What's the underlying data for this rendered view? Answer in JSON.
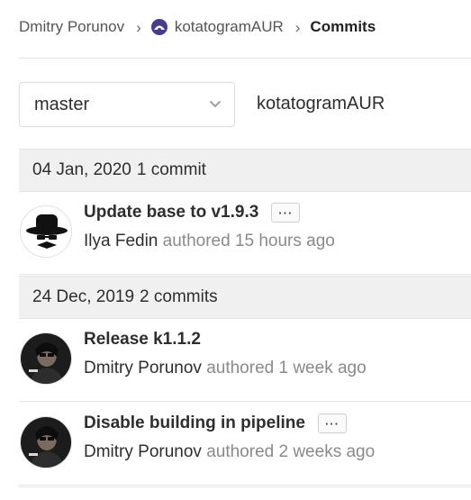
{
  "breadcrumb": {
    "user": "Dmitry Porunov",
    "project": "kotatogramAUR",
    "current": "Commits",
    "separator": "›"
  },
  "controls": {
    "branch": "master",
    "path": "kotatogramAUR"
  },
  "commit_groups": [
    {
      "date": "04 Jan, 2020",
      "count": "1 commit",
      "commits": [
        {
          "title": "Update base to v1.9.3",
          "author": "Ilya Fedin",
          "authored": "authored 15 hours ago",
          "has_description_toggle": true,
          "avatar": "hat-mustache-avatar"
        }
      ]
    },
    {
      "date": "24 Dec, 2019",
      "count": "2 commits",
      "commits": [
        {
          "title": "Release k1.1.2",
          "author": "Dmitry Porunov",
          "authored": "authored 1 week ago",
          "has_description_toggle": false,
          "avatar": "dark-portrait-avatar"
        },
        {
          "title": "Disable building in pipeline",
          "author": "Dmitry Porunov",
          "authored": "authored 2 weeks ago",
          "has_description_toggle": true,
          "avatar": "dark-portrait-avatar"
        }
      ]
    }
  ],
  "ellipsis_label": "···",
  "colors": {
    "header_bg": "#f0f0f0",
    "muted_text": "#8a8a8a",
    "project_avatar": "#4b3b8c"
  }
}
